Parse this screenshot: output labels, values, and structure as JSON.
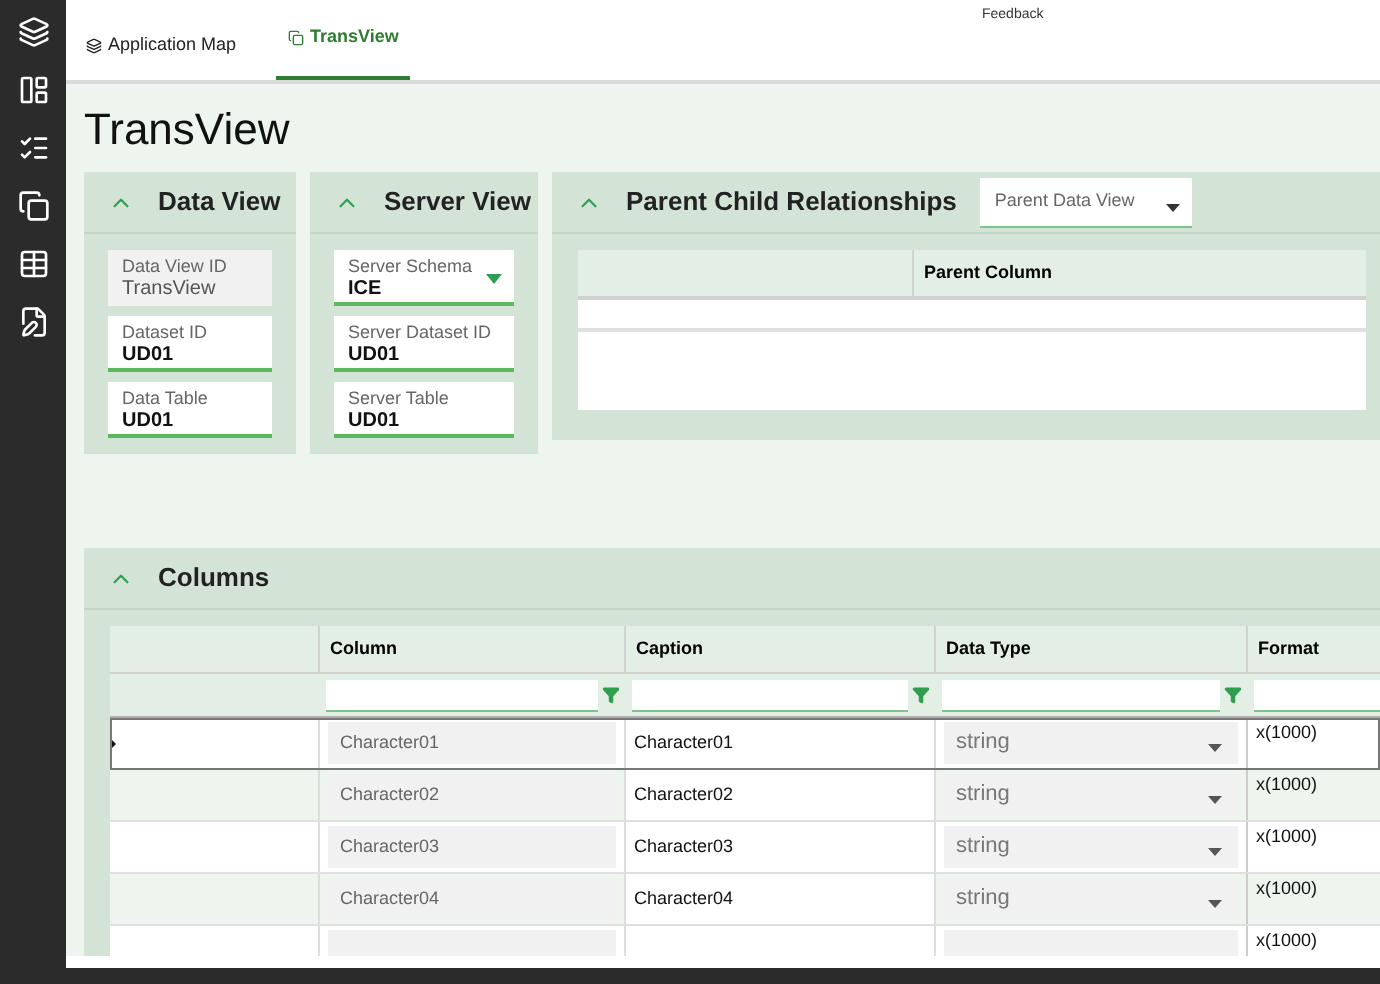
{
  "tabs": [
    {
      "label": "Application Map",
      "selected": false
    },
    {
      "label": "TransView",
      "selected": true
    }
  ],
  "feedback": "Feedback",
  "title": "TransView",
  "data_view": {
    "title": "Data View",
    "fields": [
      {
        "label": "Data View ID",
        "value": "TransView",
        "disabled": true,
        "kind": "text"
      },
      {
        "label": "Dataset ID",
        "value": "UD01",
        "disabled": false,
        "kind": "text"
      },
      {
        "label": "Data Table",
        "value": "UD01",
        "disabled": false,
        "kind": "text"
      }
    ]
  },
  "server_view": {
    "title": "Server View",
    "fields": [
      {
        "label": "Server Schema",
        "value": "ICE",
        "disabled": false,
        "kind": "select"
      },
      {
        "label": "Server Dataset ID",
        "value": "UD01",
        "disabled": false,
        "kind": "text"
      },
      {
        "label": "Server Table",
        "value": "UD01",
        "disabled": false,
        "kind": "text"
      }
    ]
  },
  "parent_child": {
    "title": "Parent Child Relationships",
    "dropdown": {
      "placeholder": "Parent Data View"
    },
    "columns": [
      "Parent Column"
    ]
  },
  "columns_panel": {
    "title": "Columns",
    "headers": [
      "Column",
      "Caption",
      "Data Type",
      "Format"
    ],
    "rows": [
      {
        "column": "Character01",
        "caption": "Character01",
        "data_type": "string",
        "format": "x(1000)",
        "selected": true
      },
      {
        "column": "Character02",
        "caption": "Character02",
        "data_type": "string",
        "format": "x(1000)",
        "selected": false
      },
      {
        "column": "Character03",
        "caption": "Character03",
        "data_type": "string",
        "format": "x(1000)",
        "selected": false
      },
      {
        "column": "Character04",
        "caption": "Character04",
        "data_type": "string",
        "format": "x(1000)",
        "selected": false
      },
      {
        "format": "x(1000)",
        "selected": false
      }
    ]
  }
}
